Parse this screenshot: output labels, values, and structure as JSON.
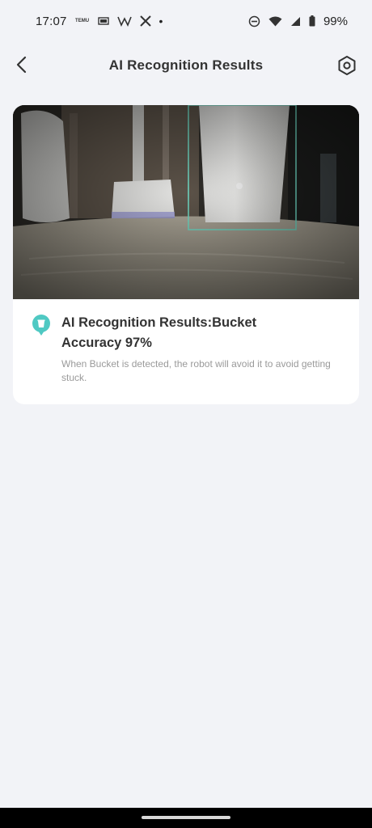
{
  "status_bar": {
    "time": "17:07",
    "temu_label": "TEMU",
    "battery": "99%",
    "icons": [
      "temu-icon",
      "app-icon",
      "w-icon",
      "x-icon",
      "dot",
      "dnd-icon",
      "wifi-icon",
      "signal-icon",
      "battery-icon"
    ]
  },
  "header": {
    "title": "AI Recognition Results",
    "back_icon": "chevron-left-icon",
    "settings_icon": "settings-icon"
  },
  "result": {
    "title_line1": "AI Recognition Results:Bucket",
    "title_line2": "Accuracy 97%",
    "description": "When Bucket is detected, the robot will avoid it to avoid getting stuck.",
    "icon": "bucket-icon",
    "accent_color": "#4fc9c3"
  },
  "colors": {
    "background": "#f2f3f7",
    "card": "#ffffff",
    "detection_box": "#6fd9c4"
  }
}
